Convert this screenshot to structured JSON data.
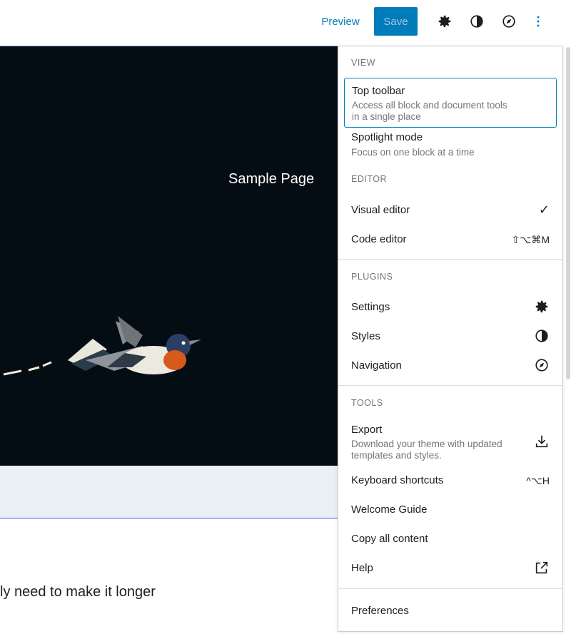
{
  "header": {
    "preview_label": "Preview",
    "save_label": "Save",
    "icons": [
      "gear-icon",
      "contrast-icon",
      "compass-icon",
      "more-vertical-icon"
    ]
  },
  "canvas": {
    "cover_title": "Sample Page",
    "body_text": "ly need to make it longer"
  },
  "menu": {
    "view": {
      "label": "View",
      "items": [
        {
          "label": "Top toolbar",
          "desc": "Access all block and document tools in a single place"
        },
        {
          "label": "Spotlight mode",
          "desc": "Focus on one block at a time"
        }
      ]
    },
    "editor": {
      "label": "Editor",
      "items": [
        {
          "label": "Visual editor",
          "right": "✓"
        },
        {
          "label": "Code editor",
          "right": "⇧⌥⌘M"
        }
      ]
    },
    "plugins": {
      "label": "Plugins",
      "items": [
        {
          "label": "Settings",
          "icon": "gear-icon"
        },
        {
          "label": "Styles",
          "icon": "contrast-icon"
        },
        {
          "label": "Navigation",
          "icon": "compass-icon"
        }
      ]
    },
    "tools": {
      "label": "Tools",
      "items": [
        {
          "label": "Export",
          "desc": "Download your theme with updated templates and styles.",
          "icon": "download-icon"
        },
        {
          "label": "Keyboard shortcuts",
          "right": "^⌥H"
        },
        {
          "label": "Welcome Guide"
        },
        {
          "label": "Copy all content"
        },
        {
          "label": "Help",
          "icon": "external-link-icon"
        }
      ]
    },
    "preferences": {
      "label": "Preferences"
    }
  },
  "colors": {
    "accent": "#007cba",
    "cover_bg": "#050d14",
    "band": "#e8eff5"
  }
}
